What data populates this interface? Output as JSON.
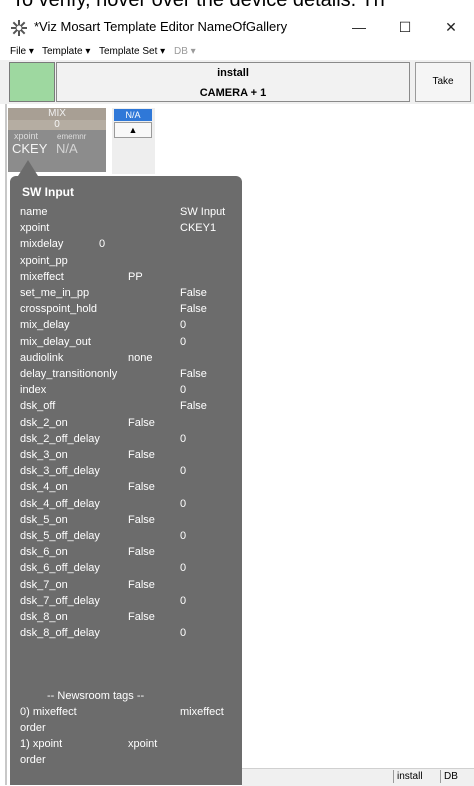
{
  "banner": {
    "text": "To verify, hover over the device details. Th"
  },
  "window": {
    "title": "*Viz Mosart Template Editor NameOfGallery",
    "minimize": "—",
    "maximize": "☐",
    "close": "✕"
  },
  "menu": [
    {
      "label": "File ▾"
    },
    {
      "label": "Template ▾"
    },
    {
      "label": "Template Set ▾"
    },
    {
      "label": "DB ▾",
      "disabled": true
    }
  ],
  "toolbar": {
    "install": "install",
    "camera": "CAMERA + 1",
    "take": "Take",
    "swatch_color": "#9ed8a0"
  },
  "mix": {
    "label": "MIX",
    "value": "0",
    "xpoint": "xpoint",
    "ememnr": "ememnr",
    "key": "CKEY",
    "na": "N/A"
  },
  "na_column": {
    "head": "N/A",
    "arrow": "▲"
  },
  "tooltip": {
    "title": "SW Input",
    "rows": [
      {
        "k": "name",
        "v": "SW Input"
      },
      {
        "k": "xpoint",
        "v": "CKEY1"
      },
      {
        "k": "mixdelay",
        "v": "0"
      },
      {
        "k": "xpoint_pp",
        "v": ""
      },
      {
        "k": "mixeffect",
        "v": "PP"
      },
      {
        "k": "set_me_in_pp",
        "v": "False"
      },
      {
        "k": "crosspoint_hold",
        "v": "False"
      },
      {
        "k": "mix_delay",
        "v": "0"
      },
      {
        "k": "mix_delay_out",
        "v": "0"
      },
      {
        "k": "audiolink",
        "v": "none"
      },
      {
        "k": "delay_transitiononly",
        "v": "False"
      },
      {
        "k": "index",
        "v": "0"
      },
      {
        "k": "dsk_off",
        "v": "False"
      },
      {
        "k": "dsk_2_on",
        "v": "False"
      },
      {
        "k": "dsk_2_off_delay",
        "v": "0"
      },
      {
        "k": "dsk_3_on",
        "v": "False"
      },
      {
        "k": "dsk_3_off_delay",
        "v": "0"
      },
      {
        "k": "dsk_4_on",
        "v": "False"
      },
      {
        "k": "dsk_4_off_delay",
        "v": "0"
      },
      {
        "k": "dsk_5_on",
        "v": "False"
      },
      {
        "k": "dsk_5_off_delay",
        "v": "0"
      },
      {
        "k": "dsk_6_on",
        "v": "False"
      },
      {
        "k": "dsk_6_off_delay",
        "v": "0"
      },
      {
        "k": "dsk_7_on",
        "v": "False"
      },
      {
        "k": "dsk_7_off_delay",
        "v": "0"
      },
      {
        "k": "dsk_8_on",
        "v": "False"
      },
      {
        "k": "dsk_8_off_delay",
        "v": "0"
      }
    ],
    "newsroom_header": "-- Newsroom tags --",
    "newsroom": [
      {
        "k": "0) mixeffect",
        "v": "mixeffect",
        "extra": "order"
      },
      {
        "k": "1) xpoint",
        "v": "xpoint",
        "extra": "order"
      }
    ]
  },
  "status": {
    "install": "install",
    "db": "DB"
  }
}
